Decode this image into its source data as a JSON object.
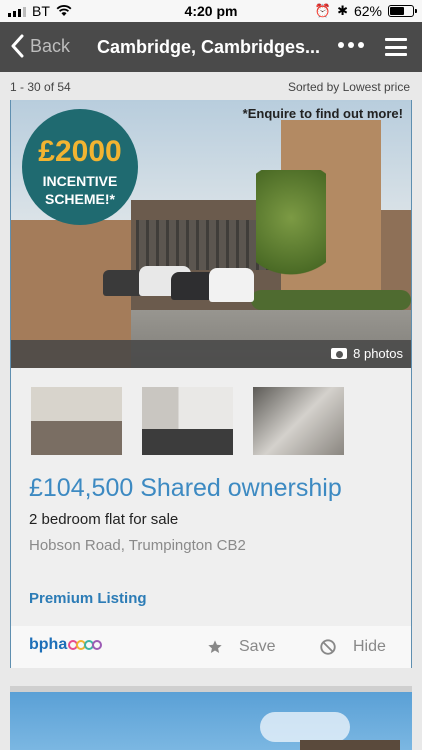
{
  "status_bar": {
    "carrier": "BT",
    "time": "4:20 pm",
    "battery": "62%",
    "battery_level": 0.62
  },
  "navbar": {
    "back_label": "Back",
    "title": "Cambridge, Cambridges...",
    "more_icon": "ellipsis-icon",
    "menu_icon": "hamburger-menu-icon"
  },
  "results": {
    "count": "1 - 30 of 54",
    "sort": "Sorted by Lowest price"
  },
  "listing": {
    "promo_amount": "£2000",
    "promo_line1": "INCENTIVE",
    "promo_line2": "SCHEME!*",
    "enquire": "*Enquire to find out more!",
    "photo_count": "8 photos",
    "price_headline": "£104,500 Shared ownership",
    "property_type": "2 bedroom flat for sale",
    "address": "Hobson Road, Trumpington CB2",
    "premium_label": "Premium Listing",
    "agent_logo": "bpha",
    "save_label": "Save",
    "hide_label": "Hide"
  },
  "colors": {
    "navbar": "#4a4a4a",
    "price": "#3d8ac2",
    "premium": "#2c7cb6",
    "card_border": "#5f8fb0",
    "promo_badge": "#1f6a70",
    "promo_amount": "#f2b431"
  }
}
